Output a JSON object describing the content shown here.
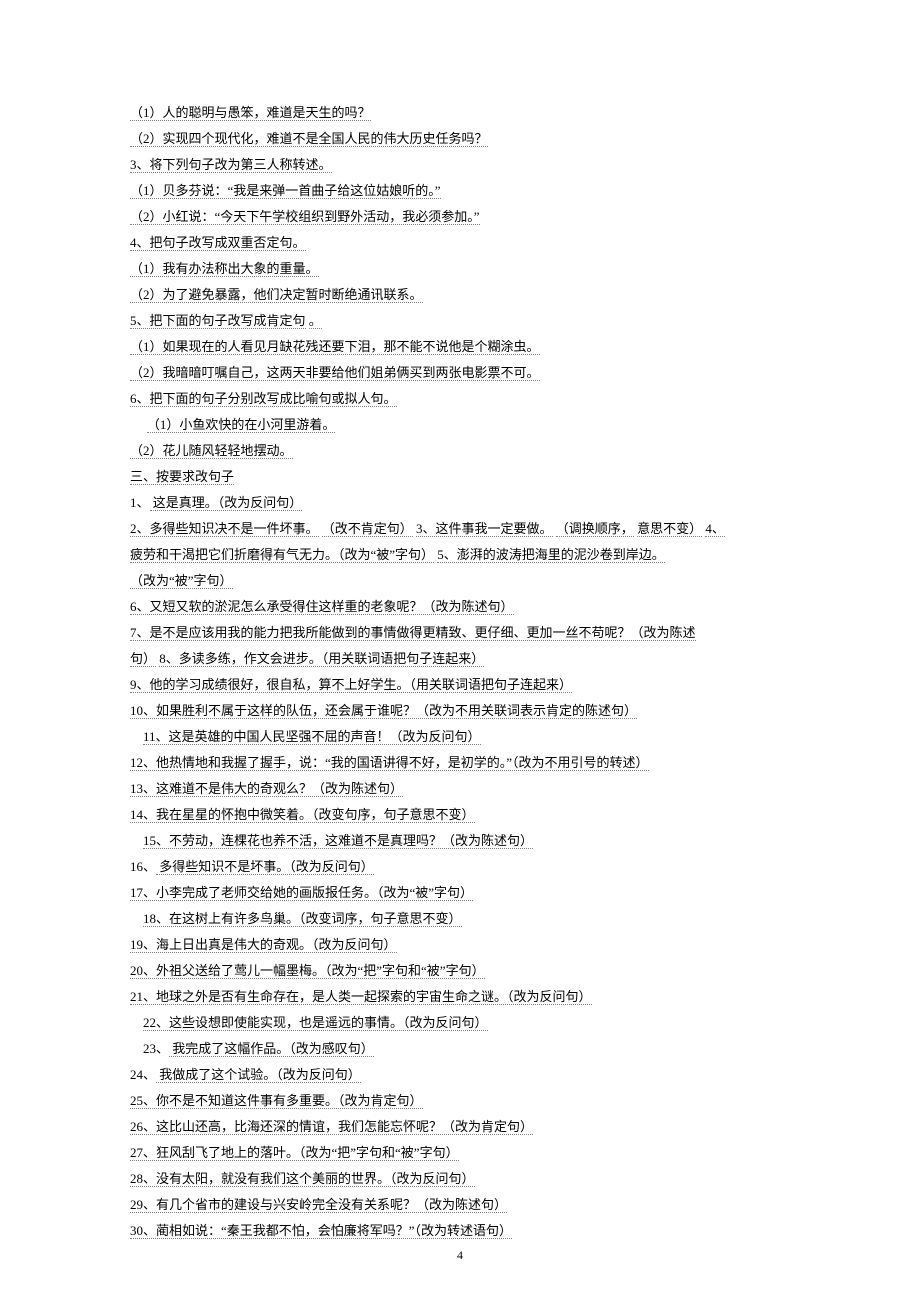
{
  "lines": [
    {
      "indent": 0,
      "segs": [
        {
          "t": "（1）人的聪明与愚笨，难道是天生的吗？",
          "u": true
        }
      ]
    },
    {
      "indent": 0,
      "segs": [
        {
          "t": "（2）实现四个现代化，难道不是全国人民的伟大历史任务吗？",
          "u": true
        }
      ]
    },
    {
      "indent": 0,
      "segs": [
        {
          "t": "3、将下列句子改为第三人称转述。",
          "u": true
        }
      ]
    },
    {
      "indent": 0,
      "segs": [
        {
          "t": "（1）贝多芬说：“我是来弹一首曲子给这位姑娘听的。”",
          "u": true
        }
      ]
    },
    {
      "indent": 0,
      "segs": [
        {
          "t": "（2）小红说：“今天下午学校组织到野外活动，我必须参加。”",
          "u": true
        }
      ]
    },
    {
      "indent": 0,
      "segs": [
        {
          "t": "4、把句子改写成双重否定句。",
          "u": true
        }
      ]
    },
    {
      "indent": 0,
      "segs": [
        {
          "t": "（1）我有办法称出大象的重量。",
          "u": true
        }
      ]
    },
    {
      "indent": 0,
      "segs": [
        {
          "t": "（2）为了避免暴露，他们决定暂时断绝通讯联系。",
          "u": true
        }
      ]
    },
    {
      "indent": 0,
      "segs": [
        {
          "t": "5、把下面的句子改写成肯定句",
          "u": true
        },
        {
          "t": "      ",
          "u": false
        },
        {
          "t": "。",
          "u": true
        }
      ]
    },
    {
      "indent": 0,
      "segs": [
        {
          "t": "（1）如果现在的人看见月缺花残还要下泪，那不能不说他是个糊涂虫。",
          "u": true
        }
      ]
    },
    {
      "indent": 0,
      "segs": [
        {
          "t": "（2）我暗暗叮嘱自己，这两天非要给他们姐弟俩买到两张电影票不可。",
          "u": true
        }
      ]
    },
    {
      "indent": 0,
      "segs": [
        {
          "t": "6、把下面的句子分别改写成比喻句或拟人句。",
          "u": true
        }
      ]
    },
    {
      "indent": 2,
      "segs": [
        {
          "t": "（1）小鱼欢快的在小河里游着。",
          "u": true
        }
      ]
    },
    {
      "indent": 0,
      "segs": [
        {
          "t": "（2）花儿随风轻轻地摆动。",
          "u": true
        }
      ]
    },
    {
      "indent": 0,
      "segs": [
        {
          "t": "三、按要求改句子",
          "u": true
        }
      ]
    },
    {
      "indent": 0,
      "segs": [
        {
          "t": "1、",
          "u": false
        },
        {
          "t": "     这是真理。（改为反问句）",
          "u": true
        }
      ]
    },
    {
      "indent": 0,
      "segs": [
        {
          "t": "2、多得些知识决不是一件坏事。",
          "u": true
        },
        {
          "t": "    ",
          "u": false
        },
        {
          "t": "（改不肯定句）",
          "u": true
        },
        {
          "t": "    ",
          "u": false
        },
        {
          "t": "3、这件事我一定要做。",
          "u": true
        },
        {
          "t": "    ",
          "u": false
        },
        {
          "t": "（调换顺序，",
          "u": true
        },
        {
          "t": "  ",
          "u": false
        },
        {
          "t": "意思不变）",
          "u": true
        },
        {
          "t": "    ",
          "u": false
        },
        {
          "t": "4、",
          "u": true
        }
      ]
    },
    {
      "indent": 0,
      "segs": [
        {
          "t": "疲劳和干渴把它们折磨得有气无力。（改为“被”字句）",
          "u": true
        },
        {
          "t": "                 ",
          "u": false
        },
        {
          "t": "5、澎湃的波涛把海里的泥沙卷到岸边。",
          "u": true
        }
      ]
    },
    {
      "indent": 0,
      "segs": [
        {
          "t": "（改为“被”字句）",
          "u": true
        }
      ]
    },
    {
      "indent": 0,
      "segs": [
        {
          "t": "6、又短又软的淤泥怎么承受得住这样重的老象呢？（改为陈述句）",
          "u": true
        }
      ]
    },
    {
      "indent": 0,
      "segs": [
        {
          "t": "7、是不是应该用我的能力把我所能做到的事情做得更精致、更仔细、更加一丝不苟呢？（改为陈述",
          "u": true
        }
      ]
    },
    {
      "indent": 0,
      "segs": [
        {
          "t": "句）",
          "u": true
        },
        {
          "t": "    ",
          "u": false
        },
        {
          "t": "8、多读多练，作文会进步。（用关联词语把句子连起来）",
          "u": true
        }
      ]
    },
    {
      "indent": 0,
      "segs": [
        {
          "t": "9、他的学习成绩很好，很自私，算不上好学生。（用关联词语把句子连起来）",
          "u": true
        }
      ]
    },
    {
      "indent": 0,
      "segs": [
        {
          "t": "10、如果胜利不属于这样的队伍，还会属于谁呢？（改为不用关联词表示肯定的陈述句）",
          "u": true
        }
      ]
    },
    {
      "indent": 1,
      "segs": [
        {
          "t": "11、这是英雄的中国人民坚强不屈的声音！（改为反问句）",
          "u": true
        }
      ]
    },
    {
      "indent": 0,
      "segs": [
        {
          "t": "12、他热情地和我握了握手，说：“我的国语讲得不好，是初学的。”（改为不用引号的转述）",
          "u": true
        }
      ]
    },
    {
      "indent": 0,
      "segs": [
        {
          "t": "13、这难道不是伟大的奇观么？（改为陈述句）",
          "u": true
        }
      ]
    },
    {
      "indent": 0,
      "segs": [
        {
          "t": "14、我在星星的怀抱中微笑着。（改变句序，句子意思不变）",
          "u": true
        }
      ]
    },
    {
      "indent": 1,
      "segs": [
        {
          "t": "15、不劳动，连棵花也养不活，这难道不是真理吗？（改为陈述句）",
          "u": true
        }
      ]
    },
    {
      "indent": 0,
      "segs": [
        {
          "t": "16、",
          "u": false
        },
        {
          "t": "     多得些知识不是坏事。（改为反问句）",
          "u": true
        }
      ]
    },
    {
      "indent": 0,
      "segs": [
        {
          "t": "17、小李完成了老师交给她的画版报任务。（改为“被”字句）",
          "u": true
        }
      ]
    },
    {
      "indent": 1,
      "segs": [
        {
          "t": "18、在这树上有许多鸟巢。（改变词序，句子意思不变）",
          "u": true
        }
      ]
    },
    {
      "indent": 0,
      "segs": [
        {
          "t": "19、海上日出真是伟大的奇观。（改为反问句）",
          "u": true
        }
      ]
    },
    {
      "indent": 0,
      "segs": [
        {
          "t": "20、外祖父送给了莺儿一幅墨梅。（改为“把”字句和“被”字句）",
          "u": true
        }
      ]
    },
    {
      "indent": 0,
      "segs": [
        {
          "t": "21、地球之外是否有生命存在，是人类一起探索的宇宙生命之谜。（改为反问句）",
          "u": true
        }
      ]
    },
    {
      "indent": 1,
      "segs": [
        {
          "t": "22、这些设想即使能实现，也是遥远的事情。（改为反问句）",
          "u": true
        }
      ]
    },
    {
      "indent": 1,
      "segs": [
        {
          "t": "23、",
          "u": false
        },
        {
          "t": "     我完成了这幅作品。（改为感叹句）",
          "u": true
        }
      ]
    },
    {
      "indent": 0,
      "segs": [
        {
          "t": "24、",
          "u": false
        },
        {
          "t": "     我做成了这个试验。（改为反问句）",
          "u": true
        }
      ]
    },
    {
      "indent": 0,
      "segs": [
        {
          "t": "25、你不是不知道这件事有多重要。（改为肯定句）",
          "u": true
        }
      ]
    },
    {
      "indent": 0,
      "segs": [
        {
          "t": "26、这比山还高，比海还深的情谊，我们怎能忘怀呢？（改为肯定句）",
          "u": true
        }
      ]
    },
    {
      "indent": 0,
      "segs": [
        {
          "t": "27、狂风刮飞了地上的落叶。（改为“把”字句和“被”字句）",
          "u": true
        }
      ]
    },
    {
      "indent": 0,
      "segs": [
        {
          "t": "28、没有太阳，就没有我们这个美丽的世界。（改为反问句）",
          "u": true
        }
      ]
    },
    {
      "indent": 0,
      "segs": [
        {
          "t": "29、有几个省市的建设与兴安岭完全没有关系呢？（改为陈述句）",
          "u": true
        }
      ]
    },
    {
      "indent": 0,
      "segs": [
        {
          "t": "30、蔺相如说：“秦王我都不怕，会怕廉将军吗？”（改为转述语句）",
          "u": true
        }
      ]
    }
  ],
  "pageNumber": "4"
}
